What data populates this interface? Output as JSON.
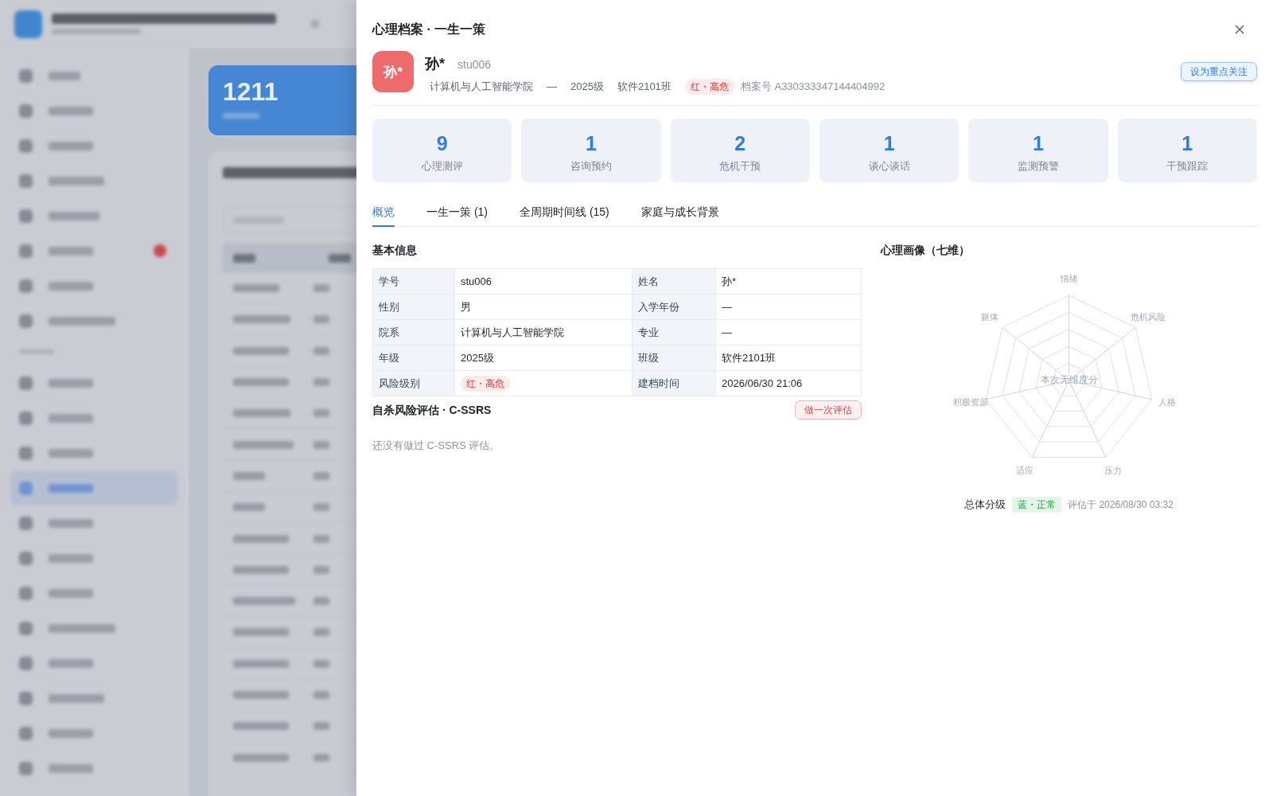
{
  "backdrop": {
    "summary_value": "1211"
  },
  "drawer": {
    "title": "心理档案 · 一生一策"
  },
  "profile": {
    "avatar_text": "孙*",
    "name": "孙*",
    "student_id": "stu006",
    "meta": [
      {
        "kind": "text",
        "text": "计算机与人工智能学院"
      },
      {
        "kind": "text",
        "text": "—"
      },
      {
        "kind": "text",
        "text": "2025级"
      },
      {
        "kind": "text",
        "text": "软件2101班"
      },
      {
        "kind": "tag",
        "text": "红・高危",
        "color": "#fdeaea"
      },
      {
        "kind": "text",
        "text": "档案号 A330333347144404992"
      }
    ],
    "action": "设为重点关注"
  },
  "stats": [
    {
      "value": "9",
      "label": "心理测评"
    },
    {
      "value": "1",
      "label": "咨询预约"
    },
    {
      "value": "2",
      "label": "危机干预"
    },
    {
      "value": "1",
      "label": "谈心谈话"
    },
    {
      "value": "1",
      "label": "监测预警"
    },
    {
      "value": "1",
      "label": "干预跟踪"
    }
  ],
  "tabs": [
    {
      "label": "概览",
      "selected": true
    },
    {
      "label": "一生一策 (1)",
      "selected": false
    },
    {
      "label": "全周期时间线 (15)",
      "selected": false
    },
    {
      "label": "家庭与成长背景",
      "selected": false
    }
  ],
  "basic_info": {
    "title": "基本信息",
    "fields": [
      {
        "label": "学号",
        "kind": "text",
        "value": "stu006"
      },
      {
        "label": "姓名",
        "kind": "text",
        "value": "孙*"
      },
      {
        "label": "性别",
        "kind": "text",
        "value": "男"
      },
      {
        "label": "入学年份",
        "kind": "text",
        "value": "—"
      },
      {
        "label": "院系",
        "kind": "text",
        "value": "计算机与人工智能学院"
      },
      {
        "label": "专业",
        "kind": "text",
        "value": "—"
      },
      {
        "label": "年级",
        "kind": "text",
        "value": "2025级"
      },
      {
        "label": "班级",
        "kind": "text",
        "value": "软件2101班"
      },
      {
        "label": "风险级别",
        "kind": "tag",
        "value": "红・高危",
        "color": "#fdeaea"
      },
      {
        "label": "建档时间",
        "kind": "text",
        "value": "2026/06/30 21:06"
      }
    ]
  },
  "cssrs": {
    "title": "自杀风险评估 · C-SSRS",
    "action": "做一次评估",
    "empty_text": "还没有做过 C-SSRS 评估。"
  },
  "portrait": {
    "title": "心理画像（七维）",
    "axes": [
      "情绪",
      "危机风险",
      "人格",
      "压力",
      "适应",
      "积极资源",
      "躯体"
    ],
    "empty_text": "本次无维度分",
    "overall_label": "总体分级",
    "overall_tag": {
      "text": "蓝・正常",
      "color": "#e4f5e9"
    },
    "assessed_at": "评估于 2026/08/30 03:32"
  }
}
